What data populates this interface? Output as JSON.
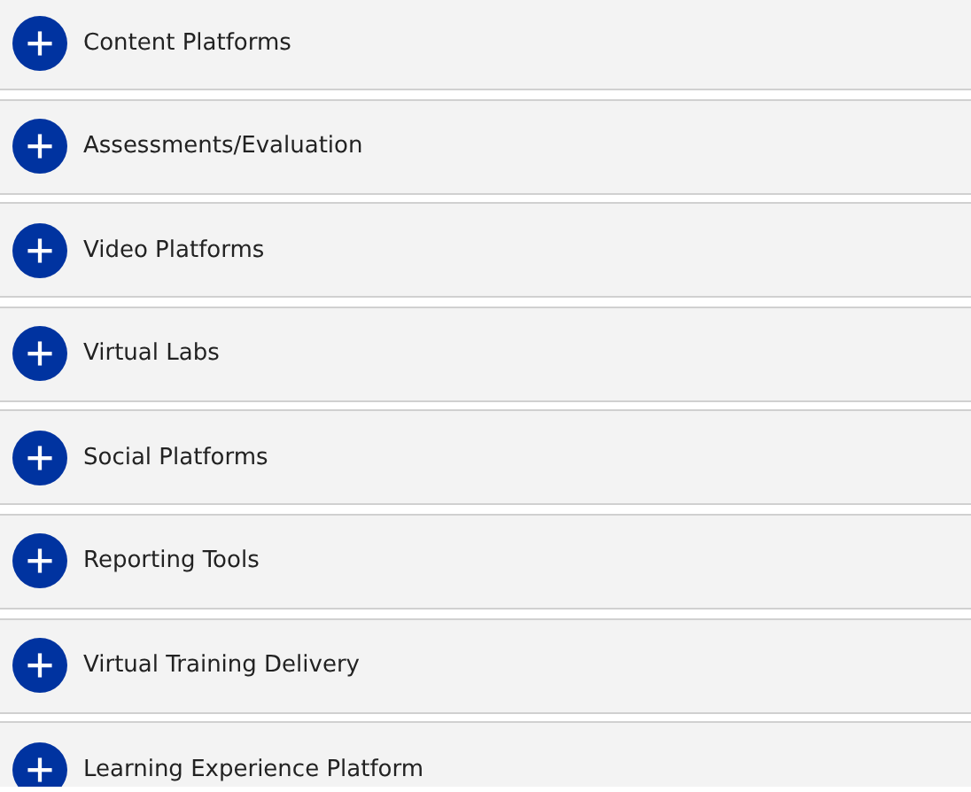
{
  "sections": [
    {
      "title": "Content Platforms",
      "expanded": false
    },
    {
      "title": "Assessments/Evaluation",
      "expanded": false
    },
    {
      "title": "Video Platforms",
      "expanded": false
    },
    {
      "title": "Virtual Labs",
      "expanded": false
    },
    {
      "title": "Social Platforms",
      "expanded": false
    },
    {
      "title": "Reporting Tools",
      "expanded": false
    },
    {
      "title": "Virtual Training Delivery",
      "expanded": false
    },
    {
      "title": "Learning Experience Platform",
      "expanded": false
    }
  ]
}
